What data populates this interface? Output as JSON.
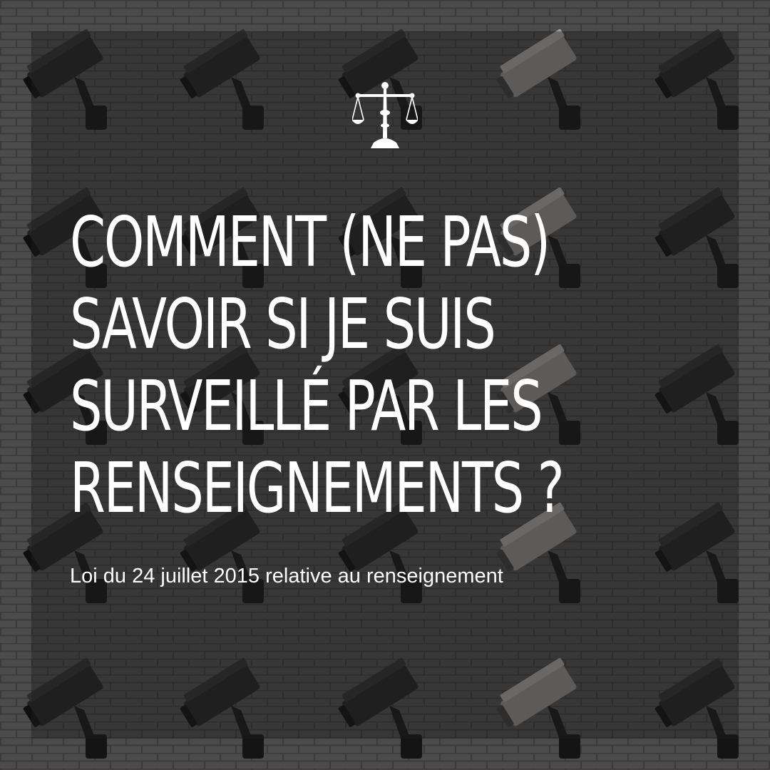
{
  "post": {
    "title_lines": [
      "COMMENT (NE PAS)",
      "SAVOIR SI JE SUIS",
      "SURVEILLÉ PAR LES",
      "RENSEIGNEMENTS ?"
    ],
    "subtitle": "Loi du 24 juillet 2015 relative au renseignement"
  },
  "emblem": {
    "icon": "scales-of-justice-icon",
    "color": "#ffffff"
  },
  "background": {
    "subject": "surveillance-cameras-on-brick-wall",
    "wall_color": "#4a4949",
    "overlay_color": "#1c1c1c"
  }
}
